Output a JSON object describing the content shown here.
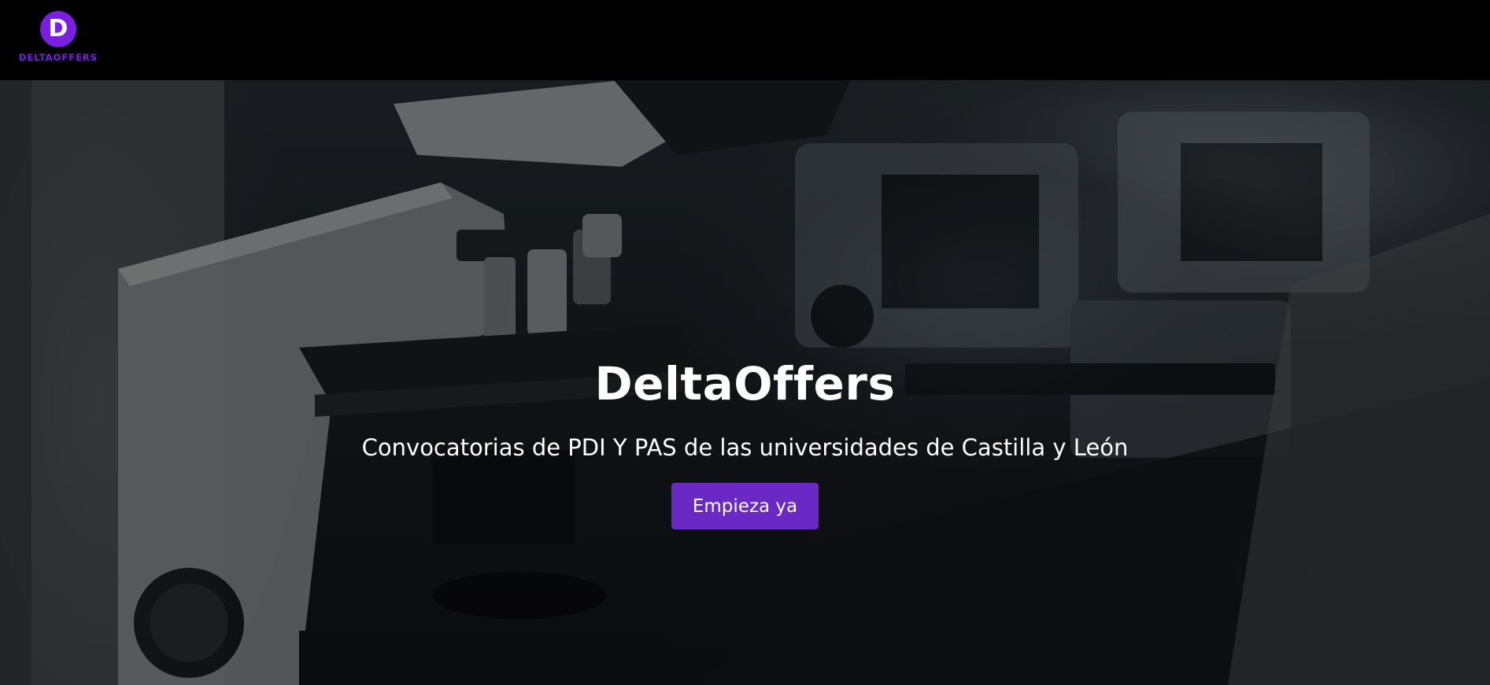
{
  "header": {
    "logo": {
      "icon_letter": "D",
      "wordmark": "DELTAOFFERS",
      "color": "#7a1fe0"
    }
  },
  "hero": {
    "background_image": "microscopes-laboratory-icon",
    "title": "DeltaOffers",
    "subtitle": "Convocatorias de PDI Y PAS de las universidades de Castilla y León",
    "cta_label": "Empieza ya",
    "cta_color": "#6a28c4"
  }
}
